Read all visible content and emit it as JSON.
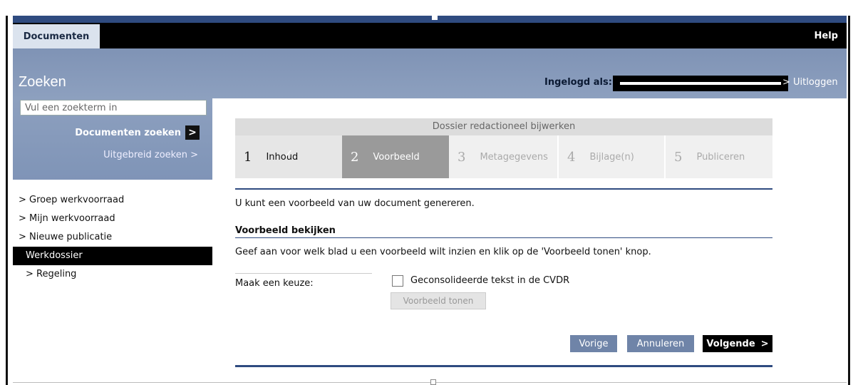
{
  "topnav": {
    "tab": "Documenten",
    "help": "Help"
  },
  "header": {
    "title": "Zoeken",
    "login_label": "Ingelogd als:",
    "logout": "> Uitloggen"
  },
  "search": {
    "placeholder": "Vul een zoekterm in",
    "button": "Documenten zoeken",
    "button_icon": ">",
    "advanced": "Uitgebreid zoeken >"
  },
  "nav": {
    "items": [
      "> Groep werkvoorraad",
      "> Mijn werkvoorraad",
      "> Nieuwe publicatie",
      "Werkdossier",
      "> Regeling"
    ]
  },
  "wizard": {
    "title": "Dossier redactioneel bijwerken",
    "steps": [
      {
        "num": "1",
        "label": "Inhoud"
      },
      {
        "num": "2",
        "label": "Voorbeeld"
      },
      {
        "num": "3",
        "label": "Metagegevens"
      },
      {
        "num": "4",
        "label": "Bijlage(n)"
      },
      {
        "num": "5",
        "label": "Publiceren"
      }
    ],
    "completed_mark": "✓"
  },
  "content": {
    "intro": "U kunt een voorbeeld van uw document genereren.",
    "section_title": "Voorbeeld bekijken",
    "instruction": "Geef aan voor welk blad u een voorbeeld wilt inzien en klik op de 'Voorbeeld tonen' knop.",
    "choice_label": "Maak een keuze:",
    "checkbox_label": "Geconsolideerde tekst in de CVDR",
    "preview_button": "Voorbeeld tonen"
  },
  "actions": {
    "previous": "Vorige",
    "cancel": "Annuleren",
    "next": "Volgende",
    "next_icon": ">"
  }
}
